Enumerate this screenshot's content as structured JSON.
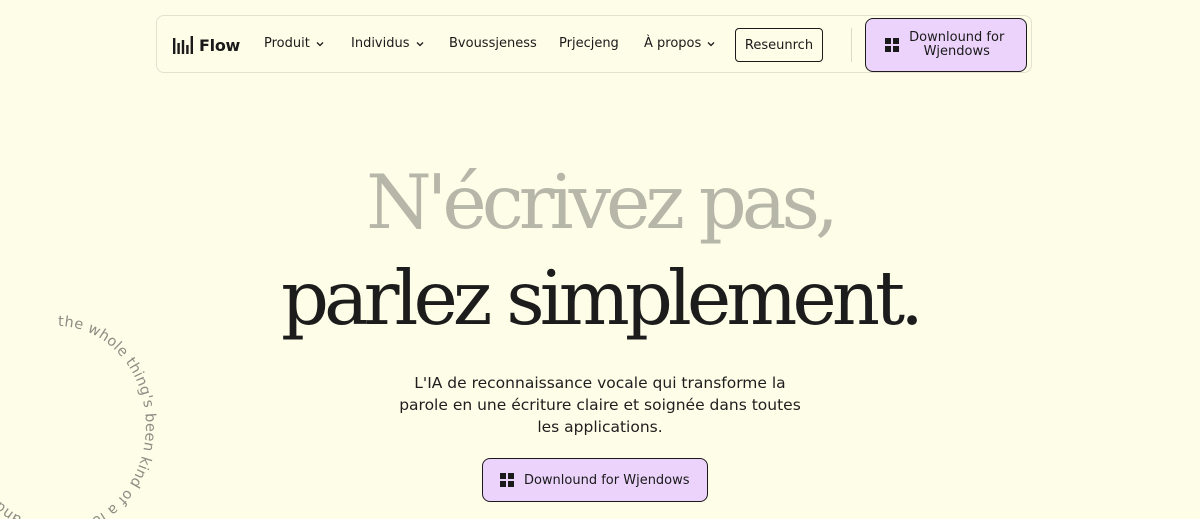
{
  "nav": {
    "logo_text": "Flow",
    "links": [
      {
        "label": "Produit",
        "dropdown": true
      },
      {
        "label": "Individus",
        "dropdown": true
      },
      {
        "label": "Bvoussjeness",
        "dropdown": false
      },
      {
        "label": "Prjecjeng",
        "dropdown": false
      },
      {
        "label": "À propos",
        "dropdown": true
      }
    ],
    "research_label": "Reseunrch",
    "download_label": "Downlound for\nWjendows"
  },
  "hero": {
    "line1": "N'écrivez pas,",
    "line2": "parlez simplement.",
    "subtitle": "L'IA de reconnaissance vocale qui transforme la parole en une écriture claire et soignée dans toutes les applications.",
    "download_label": "Downlound for Wjendows"
  },
  "decor": {
    "circle_text": "the whole thing's been kind of a lot of back and forth and honesty"
  },
  "colors": {
    "background": "#fefde8",
    "accent_button": "#ecd3fb",
    "headline_muted": "#b6b6a9",
    "text": "#1a1a1a"
  }
}
